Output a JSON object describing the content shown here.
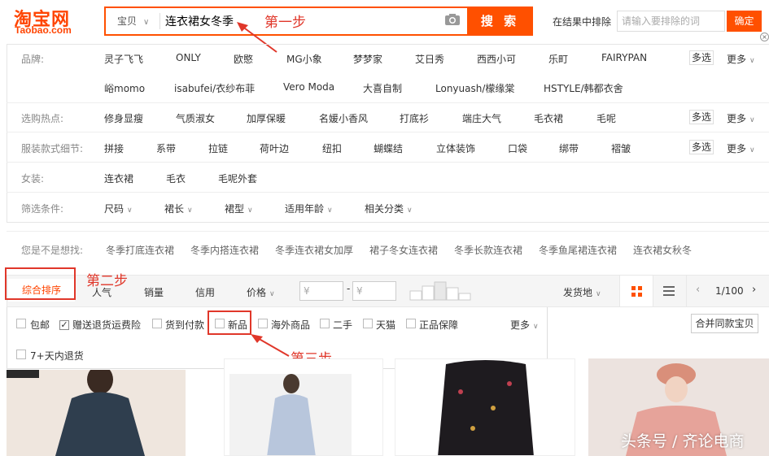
{
  "header": {
    "logo_chinese": "淘宝网",
    "logo_latin": "Taobao.com",
    "search_scope": "宝贝",
    "search_query": "连衣裙女冬季",
    "search_button": "搜 索",
    "exclude_label": "在结果中排除",
    "exclude_placeholder": "请输入要排除的词",
    "exclude_button": "确定"
  },
  "annotations": {
    "step1": "第一步",
    "step2": "第二步",
    "step3": "第三步"
  },
  "filters": {
    "multi_label": "多选",
    "more_label": "更多",
    "brand": {
      "label": "品牌:",
      "row1": [
        "灵子飞飞",
        "ONLY",
        "欧愍",
        "MG小象",
        "梦梦家",
        "艾日秀",
        "西西小可",
        "乐町",
        "FAIRYPAN"
      ],
      "row2": [
        "峪momo",
        "isabufei/衣纱布菲",
        "Vero Moda",
        "大喜自制",
        "Lonyuash/檬缘棠",
        "HSTYLE/韩都衣舍"
      ]
    },
    "hot": {
      "label": "选购热点:",
      "items": [
        "修身显瘦",
        "气质淑女",
        "加厚保暖",
        "名媛小香风",
        "打底衫",
        "端庄大气",
        "毛衣裙",
        "毛呢"
      ]
    },
    "detail": {
      "label": "服装款式细节:",
      "items": [
        "拼接",
        "系带",
        "拉链",
        "荷叶边",
        "纽扣",
        "蝴蝶结",
        "立体装饰",
        "口袋",
        "绑带",
        "褶皱"
      ]
    },
    "women": {
      "label": "女装:",
      "items": [
        "连衣裙",
        "毛衣",
        "毛呢外套"
      ]
    },
    "conditions": {
      "label": "筛选条件:",
      "items": [
        "尺码",
        "裙长",
        "裙型",
        "适用年龄",
        "相关分类"
      ]
    }
  },
  "guess": {
    "label": "您是不是想找:",
    "items": [
      "冬季打底连衣裙",
      "冬季内搭连衣裙",
      "冬季连衣裙女加厚",
      "裙子冬女连衣裙",
      "冬季长款连衣裙",
      "冬季鱼尾裙连衣裙",
      "连衣裙女秋冬"
    ]
  },
  "sort": {
    "default": "综合排序",
    "popularity": "人气",
    "sales": "销量",
    "credit": "信用",
    "price": "价格",
    "price_from": "¥",
    "price_to": "¥",
    "price_dash": "-",
    "ship_from": "发货地",
    "page": "1/100"
  },
  "features": {
    "items": [
      {
        "label": "包邮",
        "checked": false
      },
      {
        "label": "赠送退货运费险",
        "checked": true
      },
      {
        "label": "货到付款",
        "checked": false
      },
      {
        "label": "新品",
        "checked": false
      },
      {
        "label": "海外商品",
        "checked": false
      },
      {
        "label": "二手",
        "checked": false
      },
      {
        "label": "天猫",
        "checked": false
      },
      {
        "label": "正品保障",
        "checked": false
      }
    ],
    "row2": [
      {
        "label": "7+天内退货",
        "checked": false
      }
    ],
    "more": "更多",
    "merge": "合并同款宝贝"
  },
  "watermark": "头条号 / 齐论电商",
  "colors": {
    "accent": "#ff5000",
    "annotation": "#e0372a"
  }
}
